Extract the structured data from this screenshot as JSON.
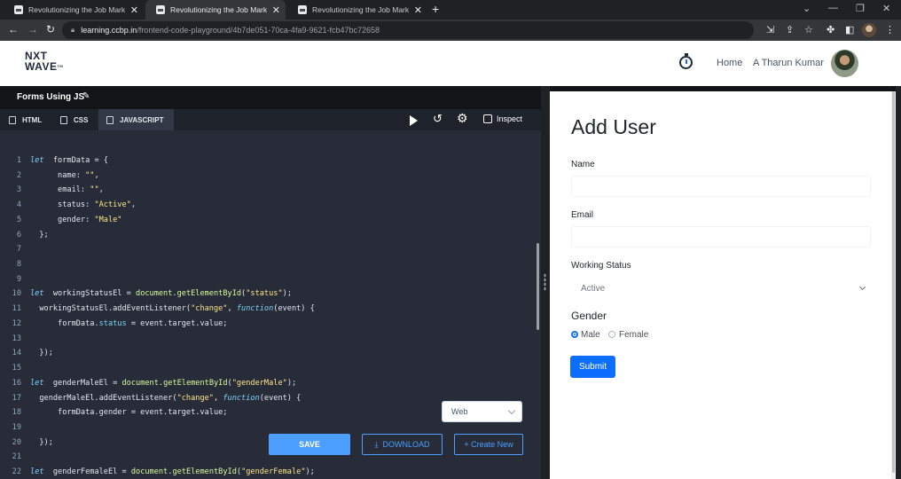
{
  "browser": {
    "tabs": [
      {
        "title": "Revolutionizing the Job Market |"
      },
      {
        "title": "Revolutionizing the Job Market |"
      },
      {
        "title": "Revolutionizing the Job Market |"
      }
    ],
    "url_host": "learning.ccbp.in",
    "url_path": "/frontend-code-playground/4b7de051-70ca-4fa9-9621-fcb47bc72658"
  },
  "header": {
    "logo_line1": "NXT",
    "logo_line2": "WAVE",
    "logo_tm": "TM",
    "home": "Home",
    "user_name": "A Tharun Kumar"
  },
  "editor": {
    "title": "Forms Using JS",
    "tabs": [
      "HTML",
      "CSS",
      "JAVASCRIPT"
    ],
    "inspect": "Inspect",
    "platform_select": "Web",
    "save": "SAVE",
    "download": "DOWNLOAD",
    "create_new": "+ Create New",
    "code": [
      {
        "n": "1",
        "tokens": [
          [
            "kw",
            "let"
          ],
          [
            "",
            "  formData = {"
          ]
        ]
      },
      {
        "n": "2",
        "tokens": [
          [
            "",
            "      name: "
          ],
          [
            "str",
            "\"\""
          ],
          [
            "",
            ","
          ]
        ]
      },
      {
        "n": "3",
        "tokens": [
          [
            "",
            "      email: "
          ],
          [
            "str",
            "\"\""
          ],
          [
            "",
            ","
          ]
        ]
      },
      {
        "n": "4",
        "tokens": [
          [
            "",
            "      status: "
          ],
          [
            "str",
            "\"Active\""
          ],
          [
            "",
            ","
          ]
        ]
      },
      {
        "n": "5",
        "tokens": [
          [
            "",
            "      gender: "
          ],
          [
            "str",
            "\"Male\""
          ]
        ]
      },
      {
        "n": "6",
        "tokens": [
          [
            "",
            "  };"
          ]
        ]
      },
      {
        "n": "7",
        "tokens": []
      },
      {
        "n": "8",
        "tokens": []
      },
      {
        "n": "9",
        "tokens": []
      },
      {
        "n": "10",
        "tokens": [
          [
            "kw",
            "let"
          ],
          [
            "",
            "  workingStatusEl = "
          ],
          [
            "fn",
            "document"
          ],
          [
            "",
            "."
          ],
          [
            "fn",
            "getElementById"
          ],
          [
            "",
            "("
          ],
          [
            "str",
            "\"status\""
          ],
          [
            "",
            ");"
          ]
        ]
      },
      {
        "n": "11",
        "tokens": [
          [
            "",
            "  workingStatusEl.addEventListener("
          ],
          [
            "str",
            "\"change\""
          ],
          [
            "",
            ", "
          ],
          [
            "kw",
            "function"
          ],
          [
            "",
            "(event) {"
          ]
        ]
      },
      {
        "n": "12",
        "tokens": [
          [
            "",
            "      formData."
          ],
          [
            "prop",
            "status"
          ],
          [
            "",
            " = event.target.value;"
          ]
        ]
      },
      {
        "n": "13",
        "tokens": []
      },
      {
        "n": "14",
        "tokens": [
          [
            "",
            "  });"
          ]
        ]
      },
      {
        "n": "15",
        "tokens": []
      },
      {
        "n": "16",
        "tokens": [
          [
            "kw",
            "let"
          ],
          [
            "",
            "  genderMaleEl = "
          ],
          [
            "fn",
            "document"
          ],
          [
            "",
            "."
          ],
          [
            "fn",
            "getElementById"
          ],
          [
            "",
            "("
          ],
          [
            "str",
            "\"genderMale\""
          ],
          [
            "",
            ");"
          ]
        ]
      },
      {
        "n": "17",
        "tokens": [
          [
            "",
            "  genderMaleEl.addEventListener("
          ],
          [
            "str",
            "\"change\""
          ],
          [
            "",
            ", "
          ],
          [
            "kw",
            "function"
          ],
          [
            "",
            "(event) {"
          ]
        ]
      },
      {
        "n": "18",
        "tokens": [
          [
            "",
            "      formData.gender = event.target.value;"
          ]
        ]
      },
      {
        "n": "19",
        "tokens": []
      },
      {
        "n": "20",
        "tokens": [
          [
            "",
            "  });"
          ]
        ]
      },
      {
        "n": "21",
        "tokens": []
      },
      {
        "n": "22",
        "tokens": [
          [
            "kw",
            "let"
          ],
          [
            "",
            "  genderFemaleEl = "
          ],
          [
            "fn",
            "document"
          ],
          [
            "",
            "."
          ],
          [
            "fn",
            "getElementById"
          ],
          [
            "",
            "("
          ],
          [
            "str",
            "\"genderFemale\""
          ],
          [
            "",
            ");"
          ]
        ]
      }
    ]
  },
  "preview": {
    "heading": "Add User",
    "name_label": "Name",
    "email_label": "Email",
    "status_label": "Working Status",
    "status_value": "Active",
    "gender_label": "Gender",
    "male": "Male",
    "female": "Female",
    "submit": "Submit"
  },
  "colors": {
    "accent": "#4c9ffe",
    "submit": "#0d6efd",
    "editor_bg": "#272c38"
  }
}
